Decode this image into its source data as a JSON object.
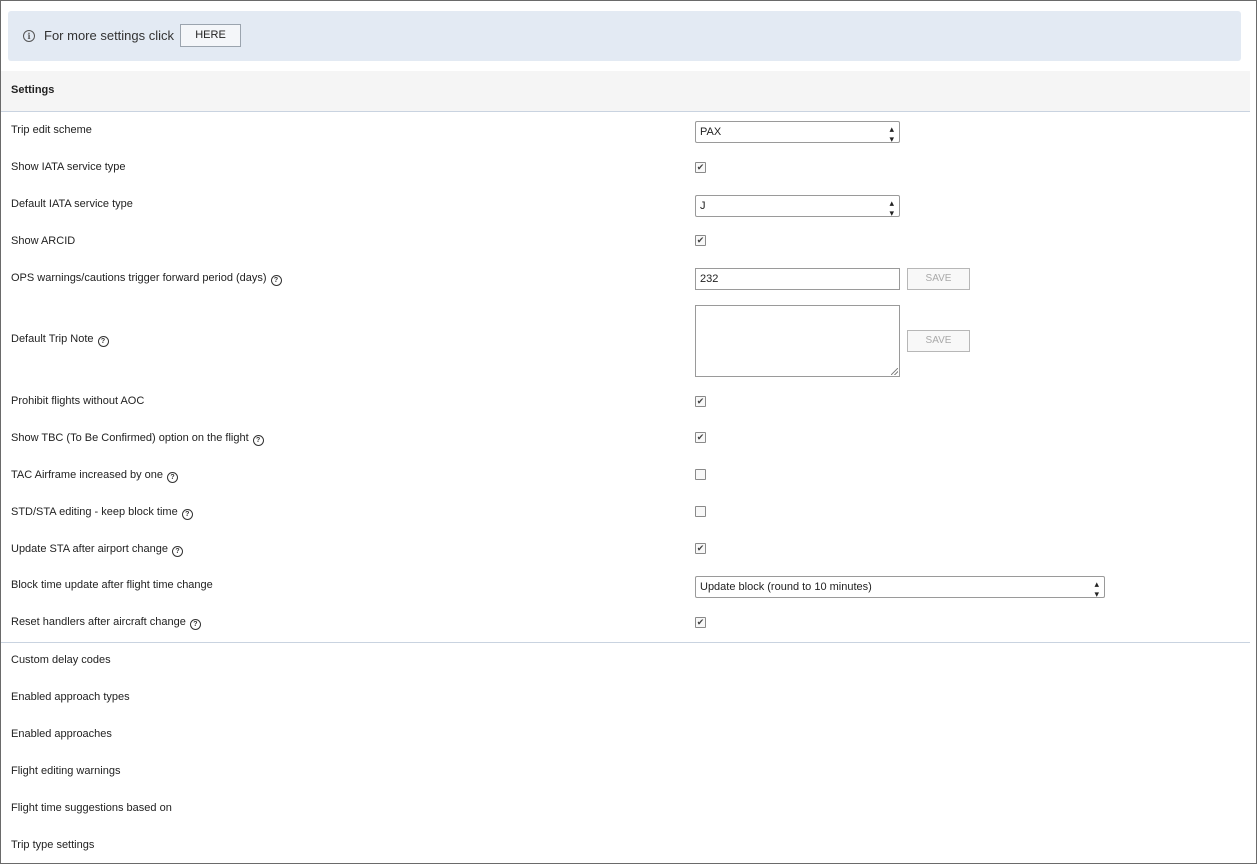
{
  "banner": {
    "icon": "info-icon",
    "text": "For more settings click",
    "button_label": "HERE"
  },
  "section": {
    "title": "Settings"
  },
  "settings": {
    "trip_edit_scheme": {
      "label": "Trip edit scheme",
      "value": "PAX"
    },
    "show_iata_service_type": {
      "label": "Show IATA service type",
      "checked": true
    },
    "default_iata_service_type": {
      "label": "Default IATA service type",
      "value": "J"
    },
    "show_arcid": {
      "label": "Show ARCID",
      "checked": true
    },
    "ops_warnings": {
      "label": "OPS warnings/cautions trigger forward period (days)",
      "value": "232",
      "save_label": "SAVE"
    },
    "default_trip_note": {
      "label": "Default Trip Note",
      "value": "",
      "save_label": "SAVE"
    },
    "prohibit_flights_without_aoc": {
      "label": "Prohibit flights without AOC",
      "checked": true
    },
    "show_tbc": {
      "label": "Show TBC (To Be Confirmed) option on the flight",
      "checked": true
    },
    "tac_airframe": {
      "label": "TAC Airframe increased by one",
      "checked": false
    },
    "std_sta_editing": {
      "label": "STD/STA editing - keep block time",
      "checked": false
    },
    "update_sta": {
      "label": "Update STA after airport change",
      "checked": true
    },
    "block_time_update": {
      "label": "Block time update after flight time change",
      "value": "Update block (round to 10 minutes)"
    },
    "reset_handlers": {
      "label": "Reset handlers after aircraft change",
      "checked": true
    }
  },
  "more_sections": [
    "Custom delay codes",
    "Enabled approach types",
    "Enabled approaches",
    "Flight editing warnings",
    "Flight time suggestions based on",
    "Trip type settings"
  ],
  "glyphs": {
    "check": "✔",
    "help": "?",
    "info": "i",
    "select_arrows": "⌃⌄"
  }
}
